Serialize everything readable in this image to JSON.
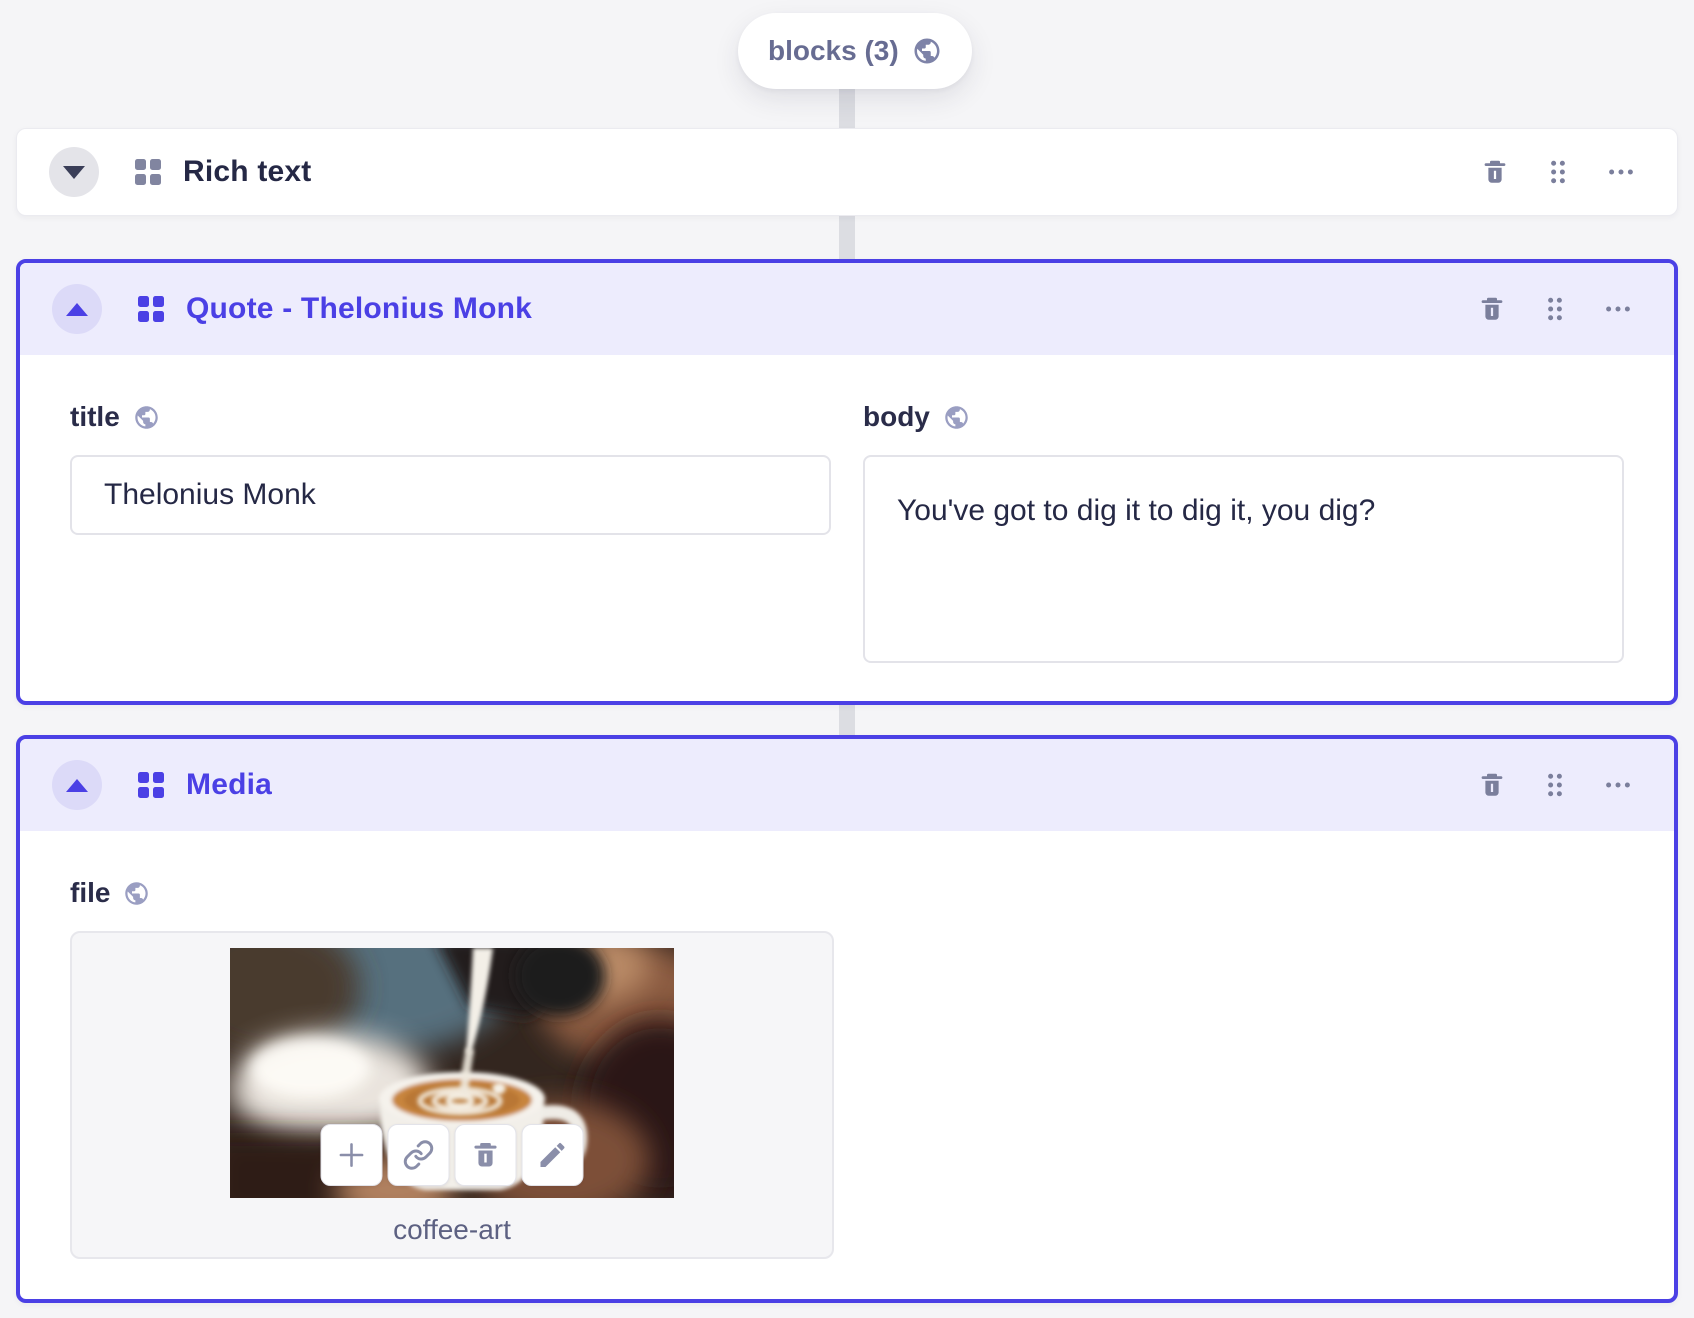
{
  "pill": {
    "label": "blocks (3)",
    "icon": "globe-icon"
  },
  "colors": {
    "accent": "#4b40e5",
    "selected_header_bg": "#edecfd",
    "page_bg": "#f5f5f7",
    "icon_gray": "#7b7f9c"
  },
  "blocks": [
    {
      "title": "Rich text",
      "collapsed": true,
      "selected": false
    },
    {
      "title": "Quote - Thelonius Monk",
      "collapsed": false,
      "selected": true,
      "fields": [
        {
          "label": "title",
          "type": "input",
          "value": "Thelonius Monk",
          "badge": "globe-icon"
        },
        {
          "label": "body",
          "type": "textarea",
          "value": "You've got to dig it to dig it, you dig?",
          "badge": "globe-icon"
        }
      ]
    },
    {
      "title": "Media",
      "collapsed": false,
      "selected": true,
      "fields": [
        {
          "label": "file",
          "type": "media",
          "filename": "coffee-art",
          "badge": "globe-icon",
          "toolbar": [
            "add-icon",
            "link-icon",
            "trash-icon",
            "edit-icon"
          ]
        }
      ]
    }
  ]
}
